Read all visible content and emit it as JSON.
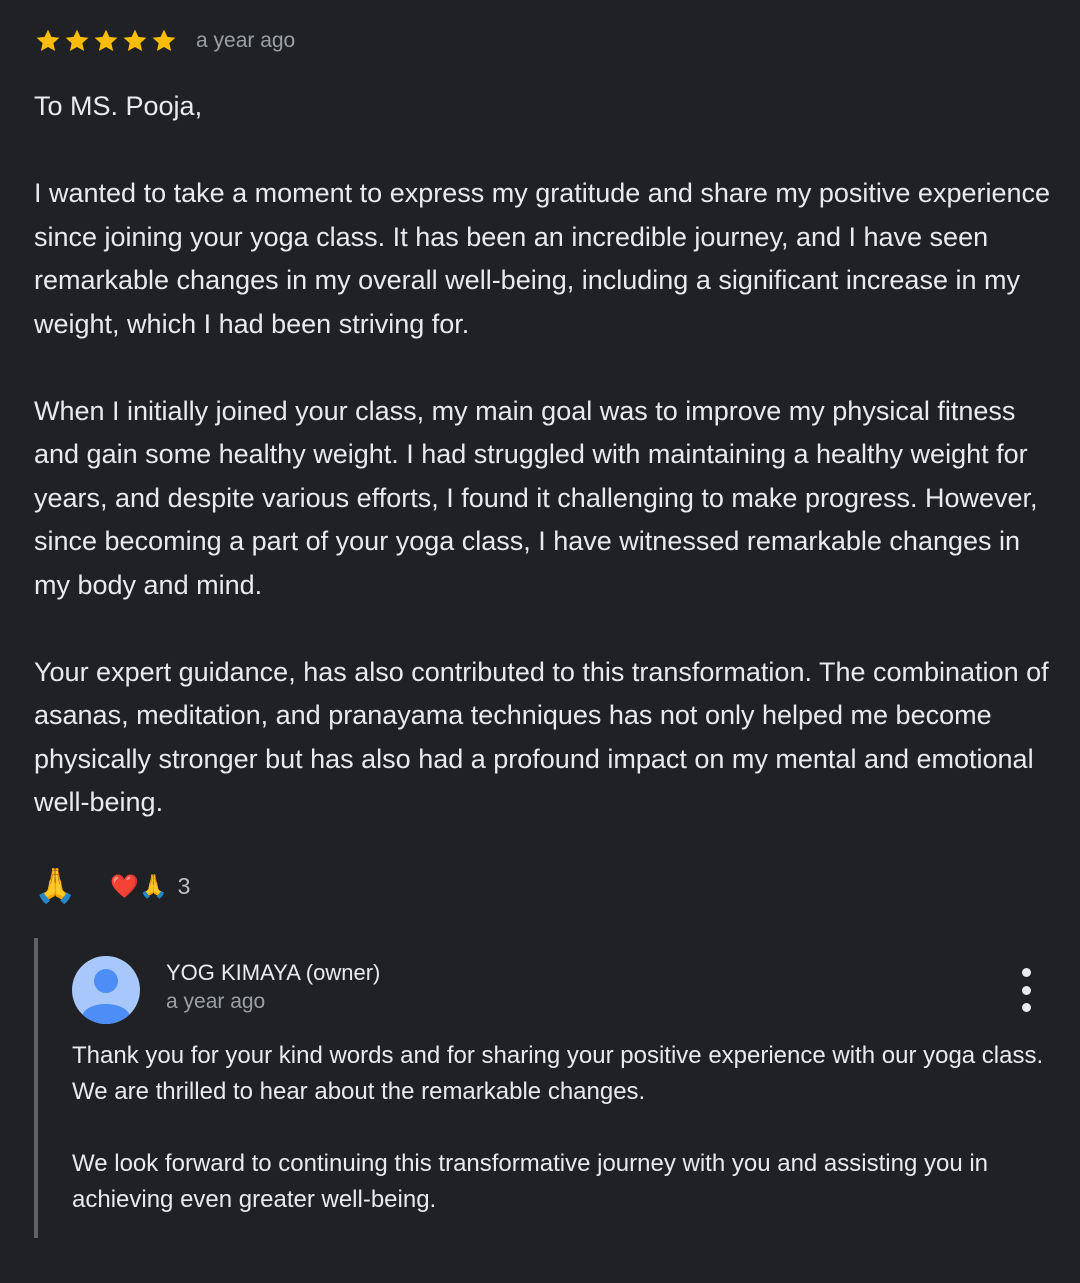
{
  "review": {
    "rating": 5,
    "rating_max": 5,
    "star_color": "#fbbc04",
    "time": "a year ago",
    "paragraphs": [
      "To MS. Pooja,",
      "I wanted to take a moment to express my gratitude and share my positive experience since joining your yoga class. It has been an incredible journey, and I have seen remarkable changes in my overall well-being, including a significant increase in my weight, which I had been striving for.",
      "When I initially joined your class, my main goal was to improve my physical fitness and gain some healthy weight. I had struggled with maintaining a healthy weight for years, and despite various efforts, I found it challenging to make progress. However, since becoming a part of your yoga class, I have witnessed remarkable changes in my body and mind.",
      "Your expert guidance, has also contributed to this transformation. The combination of asanas, meditation, and pranayama techniques has not only helped me become physically stronger but has also had a profound impact on my mental and emotional well-being."
    ]
  },
  "reactions": {
    "react_emoji": "🙏",
    "summary_emojis": "❤️🙏",
    "count": "3"
  },
  "owner_reply": {
    "name": "YOG KIMAYA (owner)",
    "time": "a year ago",
    "avatar_color": "#a8c7fa",
    "avatar_figure_color": "#4c8df6",
    "paragraphs": [
      "Thank you for your kind words and for sharing your positive experience with our yoga class. We are thrilled to hear about the remarkable changes.",
      "We look forward to continuing this transformative journey with you and assisting you in achieving even greater well-being."
    ]
  },
  "icons": {
    "star": "star-icon",
    "menu": "more-vert-icon",
    "avatar": "person-icon"
  }
}
